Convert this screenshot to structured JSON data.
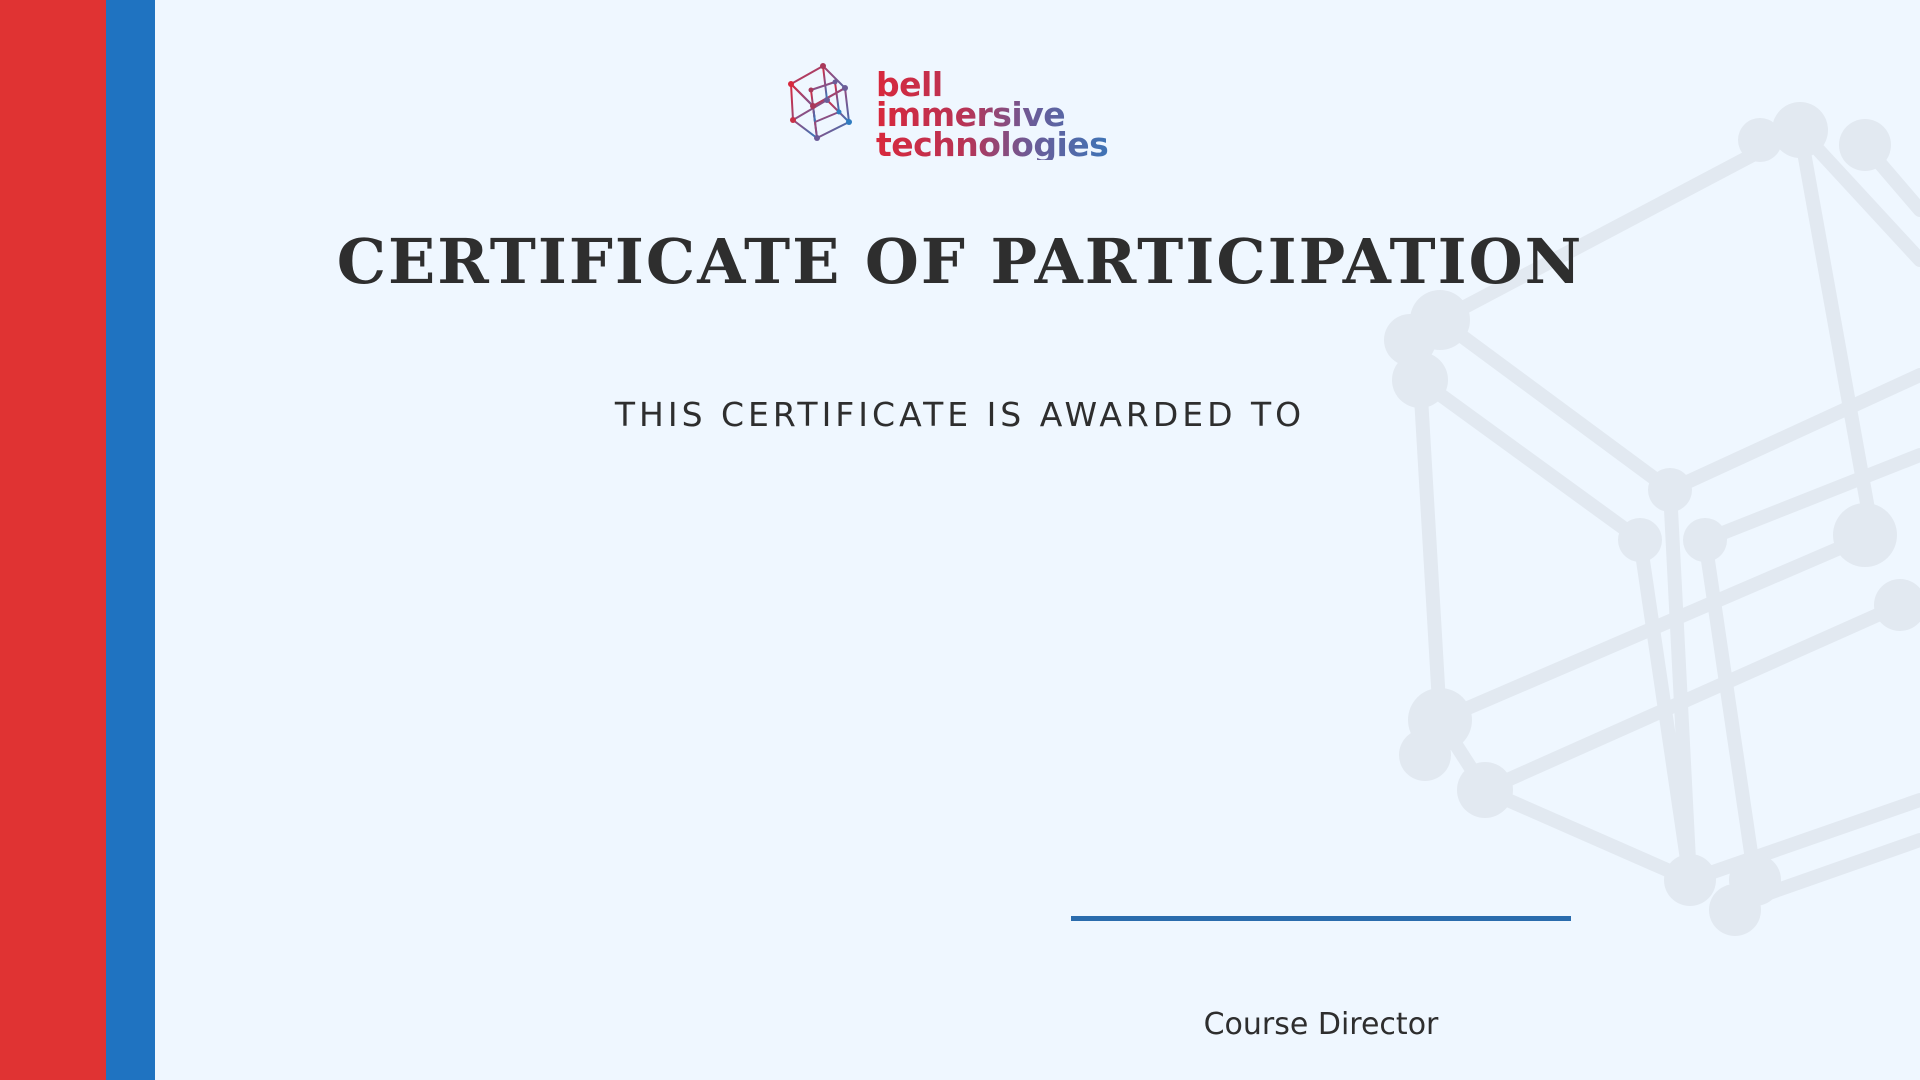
{
  "brand": {
    "line1": "bell immersive",
    "line2": "technologies",
    "gradient_colors": [
      "#d8283c",
      "#6b5c98",
      "#2f7cc0"
    ]
  },
  "certificate": {
    "title": "CERTIFICATE OF PARTICIPATION",
    "awarded_to_label": "THIS CERTIFICATE IS AWARDED TO",
    "recipient_name": "",
    "signature_label": "Course Director"
  },
  "colors": {
    "background": "#eff7ff",
    "stripe_red": "#e03333",
    "stripe_blue": "#1f73c1",
    "signature_line": "#2a6cad",
    "watermark": "#e2e9f1",
    "text": "#2e2e2e"
  },
  "icons": {
    "logo": "cube-network-icon",
    "watermark": "cube-network-watermark-icon"
  }
}
